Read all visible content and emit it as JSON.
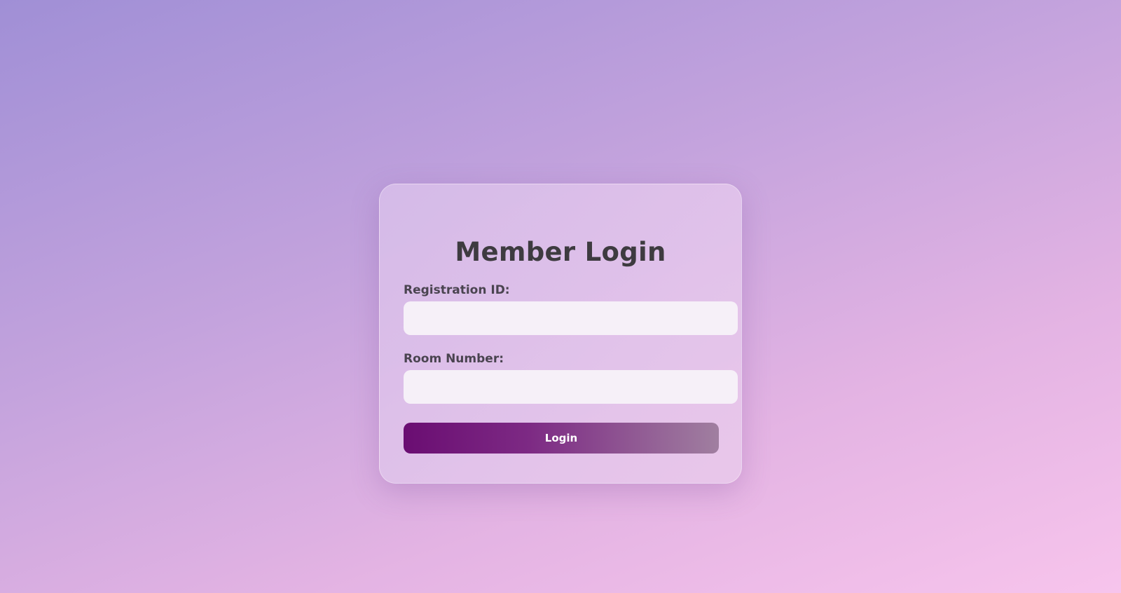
{
  "login": {
    "title": "Member Login",
    "registration_label": "Registration ID:",
    "registration_value": "",
    "room_label": "Room Number:",
    "room_value": "",
    "button_label": "Login"
  },
  "colors": {
    "button_start": "#6a0d72",
    "button_end": "#a07fa0",
    "title_text": "#3e3b40"
  }
}
